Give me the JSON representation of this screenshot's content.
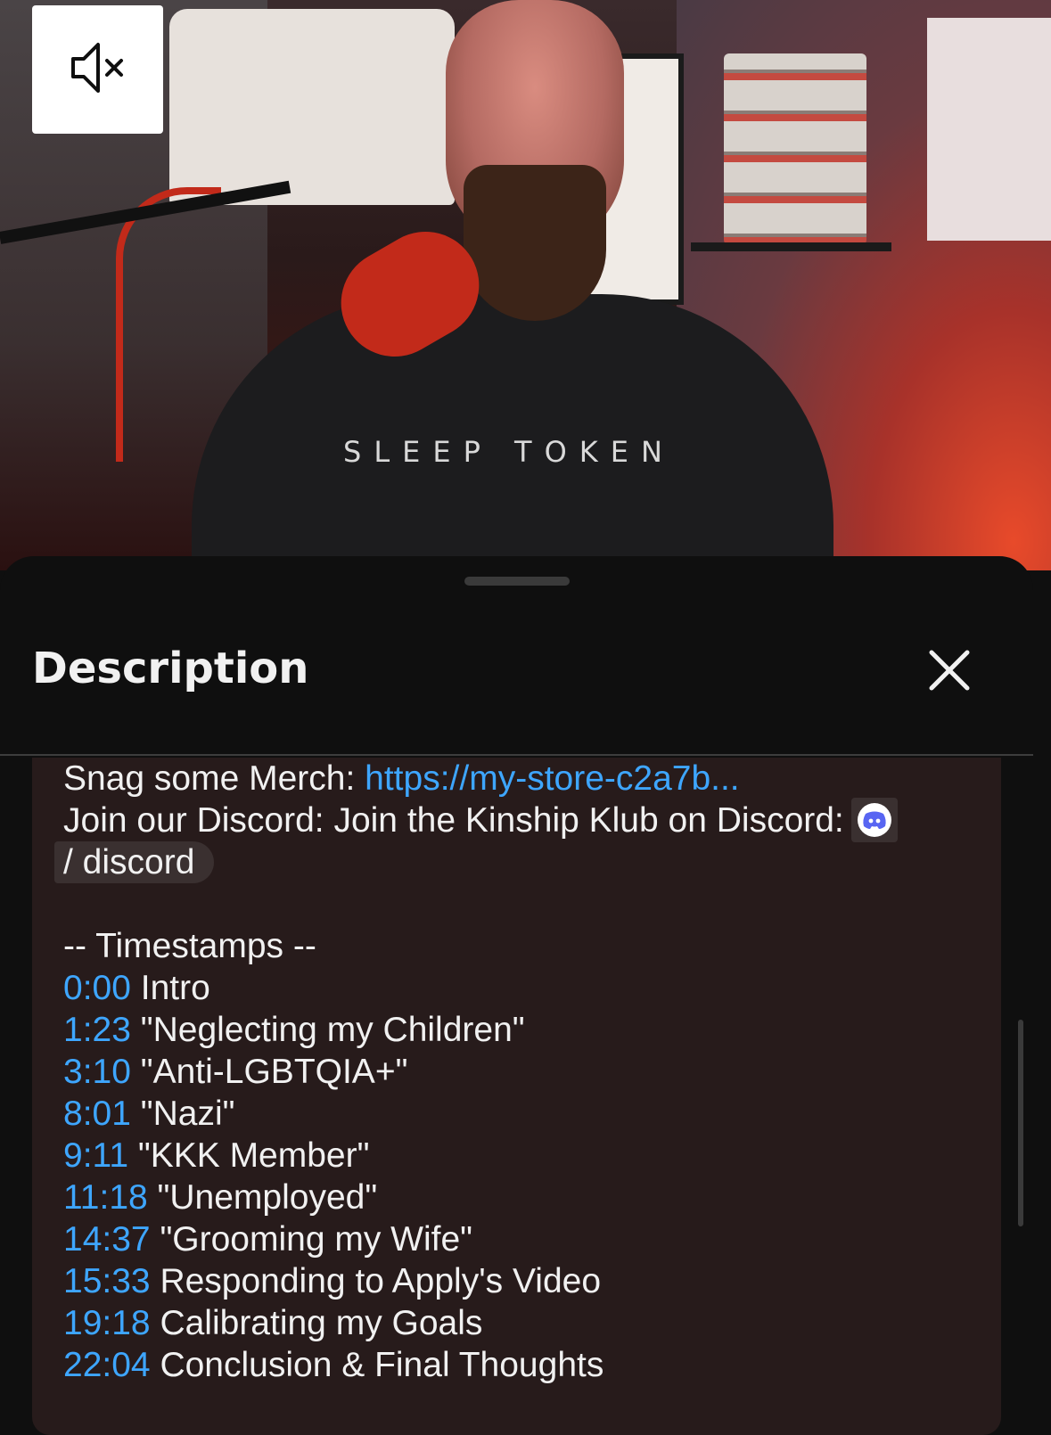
{
  "video": {
    "shirt_text": "SLEEP TOKEN",
    "mute_icon": "volume-muted-icon"
  },
  "sheet": {
    "title": "Description",
    "close_icon": "close-icon"
  },
  "description": {
    "merch_label": "Snag some Merch: ",
    "merch_link": "https://my-store-c2a7b...",
    "discord_label": "Join our Discord: Join the Kinship Klub on Discord:",
    "discord_icon": "discord-icon",
    "discord_handle": "/ discord",
    "timestamps_header": "-- Timestamps --",
    "timestamps": [
      {
        "time": "0:00",
        "title": " Intro"
      },
      {
        "time": "1:23",
        "title": " \"Neglecting my Children\""
      },
      {
        "time": "3:10",
        "title": " \"Anti-LGBTQIA+\""
      },
      {
        "time": "8:01",
        "title": " \"Nazi\""
      },
      {
        "time": "9:11",
        "title": " \"KKK Member\""
      },
      {
        "time": "11:18",
        "title": " \"Unemployed\""
      },
      {
        "time": "14:37",
        "title": " \"Grooming my Wife\""
      },
      {
        "time": "15:33",
        "title": " Responding to Apply's Video"
      },
      {
        "time": "19:18",
        "title": " Calibrating my Goals"
      },
      {
        "time": "22:04",
        "title": " Conclusion & Final Thoughts"
      }
    ]
  },
  "colors": {
    "link": "#3ea6ff",
    "sheet_bg": "#0f0f0f",
    "desc_bg": "#271b1b"
  }
}
